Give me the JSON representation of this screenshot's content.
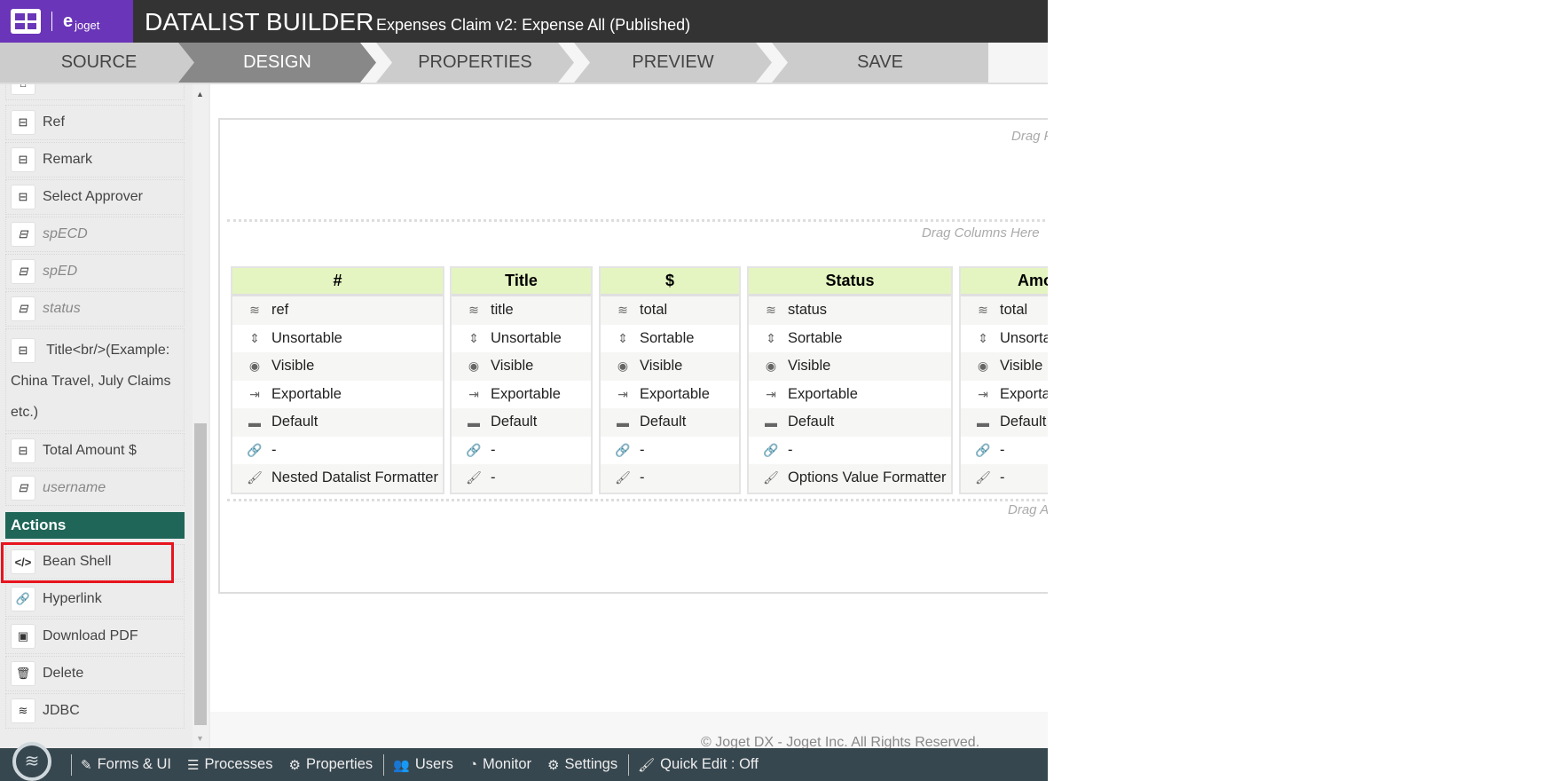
{
  "header": {
    "brand": "joget",
    "title": "DATALIST BUILDER",
    "subtitle": "Expenses Claim v2: Expense All (Published)"
  },
  "tabs": [
    {
      "label": "SOURCE"
    },
    {
      "label": "DESIGN"
    },
    {
      "label": "PROPERTIES"
    },
    {
      "label": "PREVIEW"
    },
    {
      "label": "SAVE"
    }
  ],
  "sidebar": {
    "columns": [
      {
        "label": "Ref"
      },
      {
        "label": "Remark"
      },
      {
        "label": "Select Approver"
      },
      {
        "label": "spECD"
      },
      {
        "label": "spED"
      },
      {
        "label": "status"
      },
      {
        "label": "Title<br/>(Example: China Travel, July Claims etc.)"
      },
      {
        "label": "Total Amount $"
      },
      {
        "label": "username"
      }
    ],
    "actions_header": "Actions",
    "actions": [
      {
        "label": "Bean Shell",
        "icon": "code-icon"
      },
      {
        "label": "Hyperlink",
        "icon": "link-icon"
      },
      {
        "label": "Download PDF",
        "icon": "download-pdf-icon"
      },
      {
        "label": "Delete",
        "icon": "trash-icon"
      },
      {
        "label": "JDBC",
        "icon": "database-icon"
      }
    ]
  },
  "canvas": {
    "drag_filters": "Drag Filters Here",
    "drag_columns": "Drag Columns Here",
    "drag_actions": "Drag Actions Here"
  },
  "columns": [
    {
      "header": "#",
      "field": "ref",
      "sort": "Unsortable",
      "visible": "Visible",
      "export": "Exportable",
      "width": "Default",
      "link": "-",
      "formatter": "Nested Datalist Formatter"
    },
    {
      "header": "Title",
      "field": "title",
      "sort": "Unsortable",
      "visible": "Visible",
      "export": "Exportable",
      "width": "Default",
      "link": "-",
      "formatter": "-"
    },
    {
      "header": "$",
      "field": "total",
      "sort": "Sortable",
      "visible": "Visible",
      "export": "Exportable",
      "width": "Default",
      "link": "-",
      "formatter": "-"
    },
    {
      "header": "Status",
      "field": "status",
      "sort": "Sortable",
      "visible": "Visible",
      "export": "Exportable",
      "width": "Default",
      "link": "-",
      "formatter": "Options Value Formatter"
    },
    {
      "header": "Amount",
      "field": "total",
      "sort": "Unsortable",
      "visible": "Visible",
      "export": "Exportable",
      "width": "Default",
      "link": "-",
      "formatter": "-"
    }
  ],
  "footer": {
    "copyright": "© Joget DX - Joget Inc. All Rights Reserved."
  },
  "bottombar": {
    "items": [
      {
        "label": "Forms & UI"
      },
      {
        "label": "Processes"
      },
      {
        "label": "Properties"
      },
      {
        "label": "Users"
      },
      {
        "label": "Monitor"
      },
      {
        "label": "Settings"
      },
      {
        "label": "Quick Edit : Off"
      }
    ]
  },
  "colors": {
    "brand": "#6a35b8",
    "actions": "#1f6658",
    "highlight": "#e8141e",
    "column_header": "#e4f5c1"
  }
}
